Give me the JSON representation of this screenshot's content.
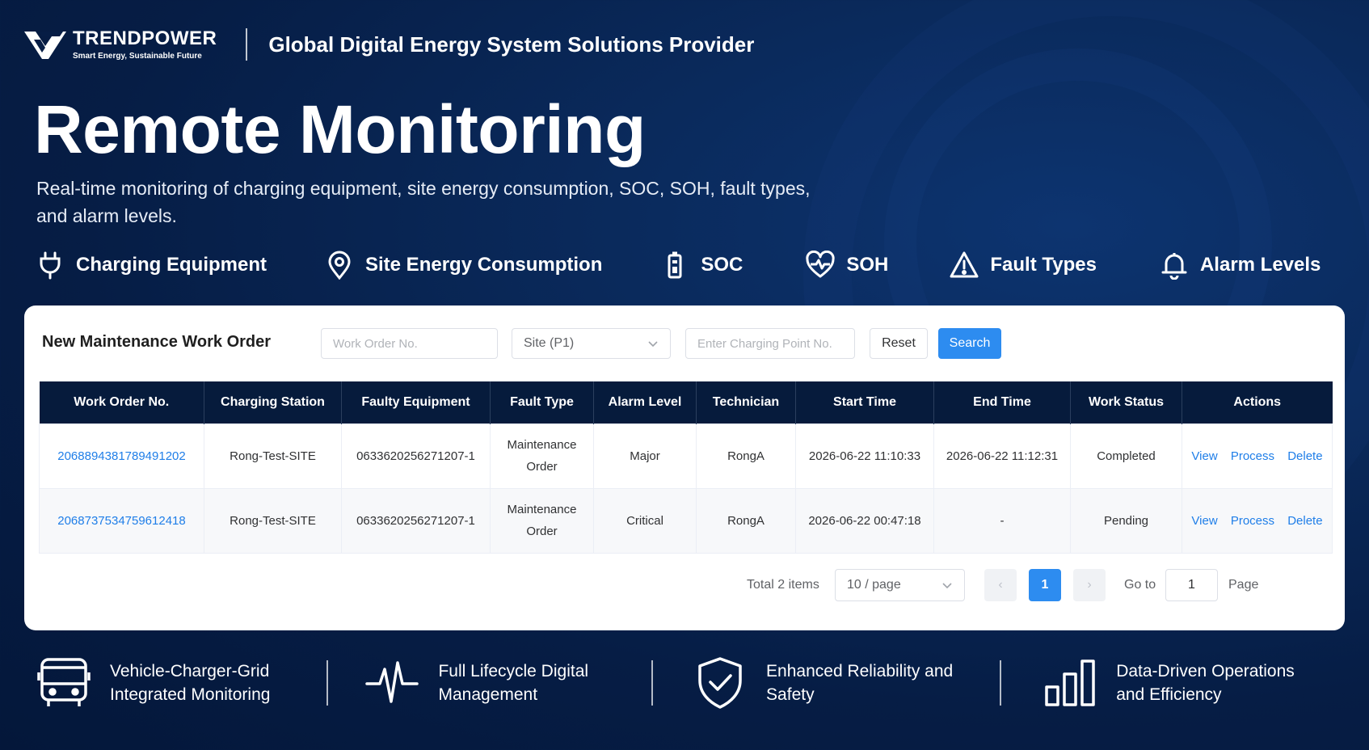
{
  "brand": {
    "name": "TRENDPOWER",
    "tagline": "Smart Energy, Sustainable Future",
    "slogan": "Global Digital Energy System Solutions Provider"
  },
  "hero": {
    "title": "Remote Monitoring",
    "description": "Real-time monitoring of charging equipment, site energy consumption, SOC, SOH, fault types, and alarm levels."
  },
  "features": [
    {
      "icon": "plug-icon",
      "label": "Charging Equipment"
    },
    {
      "icon": "location-pin-icon",
      "label": "Site Energy Consumption"
    },
    {
      "icon": "battery-icon",
      "label": "SOC"
    },
    {
      "icon": "heart-pulse-icon",
      "label": "SOH"
    },
    {
      "icon": "warning-triangle-icon",
      "label": "Fault Types"
    },
    {
      "icon": "bell-icon",
      "label": "Alarm Levels"
    }
  ],
  "panel": {
    "title": "New Maintenance Work Order",
    "filters": {
      "work_order_placeholder": "Work Order No.",
      "site_selected": "Site (P1)",
      "charging_point_placeholder": "Enter Charging Point No.",
      "reset_label": "Reset",
      "search_label": "Search"
    },
    "table": {
      "columns": [
        "Work Order No.",
        "Charging Station",
        "Faulty Equipment",
        "Fault Type",
        "Alarm Level",
        "Technician",
        "Start Time",
        "End Time",
        "Work Status",
        "Actions"
      ],
      "rows": [
        {
          "work_order_no": "2068894381789491202",
          "charging_station": "Rong-Test-SITE",
          "faulty_equipment": "0633620256271207-1",
          "fault_type_line1": "Maintenance",
          "fault_type_line2": "Order",
          "alarm_level": "Major",
          "technician": "RongA",
          "start_time": "2026-06-22 11:10:33",
          "end_time": "2026-06-22 11:12:31",
          "work_status": "Completed"
        },
        {
          "work_order_no": "2068737534759612418",
          "charging_station": "Rong-Test-SITE",
          "faulty_equipment": "0633620256271207-1",
          "fault_type_line1": "Maintenance",
          "fault_type_line2": "Order",
          "alarm_level": "Critical",
          "technician": "RongA",
          "start_time": "2026-06-22 00:47:18",
          "end_time": "-",
          "work_status": "Pending"
        }
      ],
      "action_labels": {
        "view": "View",
        "process": "Process",
        "delete": "Delete"
      }
    },
    "pagination": {
      "total": "Total 2 items",
      "page_size": "10 / page",
      "prev": "‹",
      "current_page": "1",
      "next": "›",
      "goto_label": "Go to",
      "goto_value": "1",
      "page_label": "Page"
    }
  },
  "bottom": [
    {
      "icon": "bus-icon",
      "line1": "Vehicle-Charger-Grid",
      "line2": "Integrated Monitoring"
    },
    {
      "icon": "pulse-icon",
      "line1": "Full Lifecycle Digital",
      "line2": "Management"
    },
    {
      "icon": "shield-check-icon",
      "line1": "Enhanced Reliability and",
      "line2": "Safety"
    },
    {
      "icon": "bar-chart-icon",
      "line1": "Data-Driven Operations",
      "line2": "and Efficiency"
    }
  ],
  "colors": {
    "accent": "#2d8cf0",
    "link": "#1f7ee8",
    "table_header": "#061b3c",
    "background": "#061d45"
  }
}
